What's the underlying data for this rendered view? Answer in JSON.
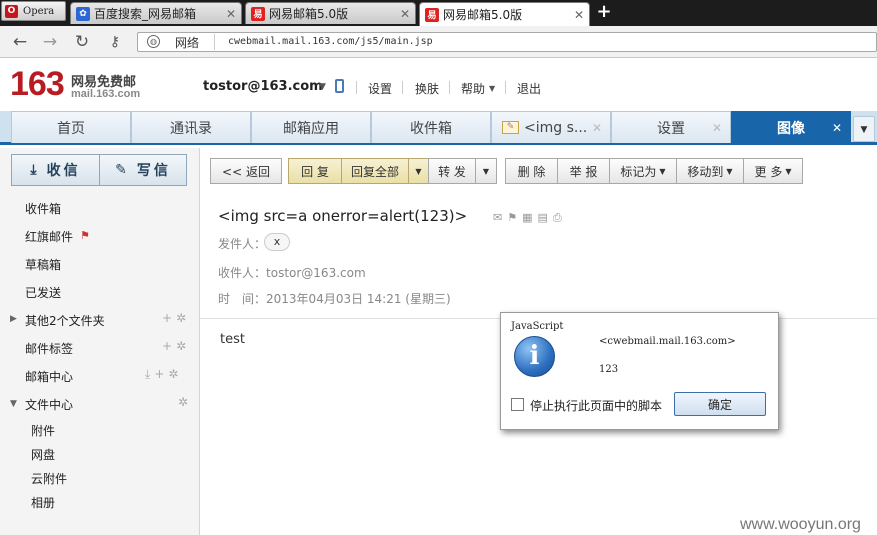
{
  "browser": {
    "menu_label": "Opera",
    "tabs": [
      {
        "title": "百度搜索_网易邮箱",
        "icon": "baidu-paw-icon"
      },
      {
        "title": "网易邮箱5.0版",
        "icon": "netease-163-icon"
      },
      {
        "title": "网易邮箱5.0版",
        "icon": "netease-163-icon"
      }
    ],
    "close_glyph": "✕",
    "new_tab_glyph": "+",
    "address": {
      "zone_label": "网络",
      "url": "cwebmail.mail.163.com/js5/main.jsp"
    }
  },
  "mail": {
    "logo": {
      "number": "163",
      "name": "网易免费邮",
      "domain": "mail.163.com"
    },
    "user": "tostor@163.com",
    "header_links": [
      "设置",
      "换肤",
      "帮助",
      "退出"
    ],
    "tabs": [
      "首页",
      "通讯录",
      "邮箱应用",
      "收件箱",
      "<img s...",
      "设置",
      "图像"
    ],
    "sidebar": {
      "receive": "收信",
      "compose": "写信",
      "folders": [
        "收件箱",
        "红旗邮件",
        "草稿箱",
        "已发送",
        "其他2个文件夹",
        "邮件标签",
        "邮箱中心",
        "文件中心"
      ],
      "file_center_items": [
        "附件",
        "网盘",
        "云附件",
        "相册"
      ]
    },
    "toolbar": {
      "back": "<< 返回",
      "reply": "回 复",
      "reply_all": "回复全部",
      "forward": "转 发",
      "delete": "删 除",
      "report": "举 报",
      "mark_as": "标记为",
      "move_to": "移动到",
      "more": "更 多"
    },
    "message": {
      "subject": "<img src=a onerror=alert(123)>",
      "from_label": "发件人：",
      "from_value": "x",
      "to_label": "收件人：",
      "to_value": "tostor@163.com",
      "time_label": "时　间：",
      "time_value": "2013年04月03日 14:21 (星期三)",
      "body": "test"
    }
  },
  "dialog": {
    "title": "JavaScript",
    "source": "<cwebmail.mail.163.com>",
    "message": "123",
    "checkbox_label": "停止执行此页面中的脚本",
    "ok_label": "确定"
  },
  "watermark": "www.wooyun.org",
  "colors": {
    "brand_red": "#b81c22",
    "tab_active_blue": "#1865aa",
    "reply_yellow": "#e9dfa6"
  }
}
